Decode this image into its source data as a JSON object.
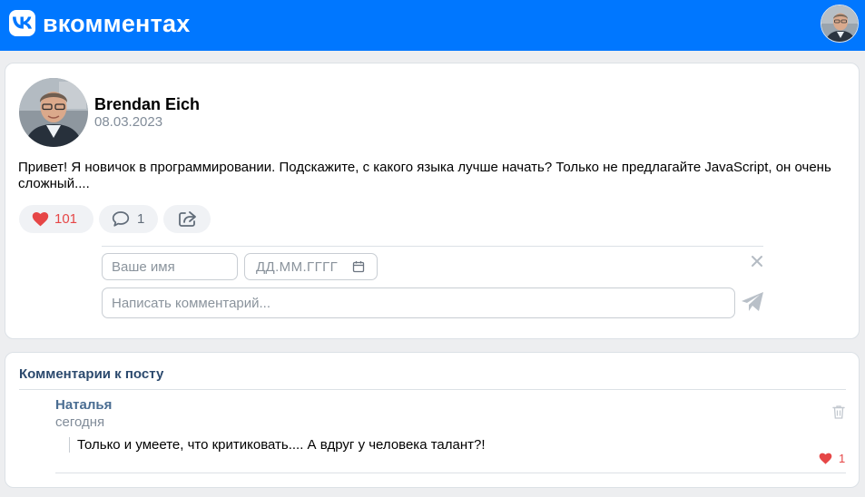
{
  "header": {
    "brand": "вкомментах",
    "logo_icon": "vk-logo-icon",
    "avatar_icon": "user-avatar"
  },
  "post": {
    "author": "Brendan Eich",
    "date": "08.03.2023",
    "text": "Привет! Я новичок в программировании. Подскажите, с какого языка лучше начать? Только не предлагайте JavaScript, он очень сложный....",
    "likes": "101",
    "comments": "1"
  },
  "comment_form": {
    "name_placeholder": "Ваше имя",
    "date_placeholder": "ДД.ММ.ГГГГ",
    "comment_placeholder": "Написать комментарий..."
  },
  "comments": {
    "title": "Комментарии к посту",
    "items": [
      {
        "author": "Наталья",
        "date": "сегодня",
        "text": "Только и умеете, что критиковать.... А вдруг у человека талант?!",
        "likes": "1"
      }
    ]
  },
  "colors": {
    "accent": "#0077ff",
    "like": "#e64646",
    "link": "#4a6d92",
    "muted": "#818c99"
  }
}
